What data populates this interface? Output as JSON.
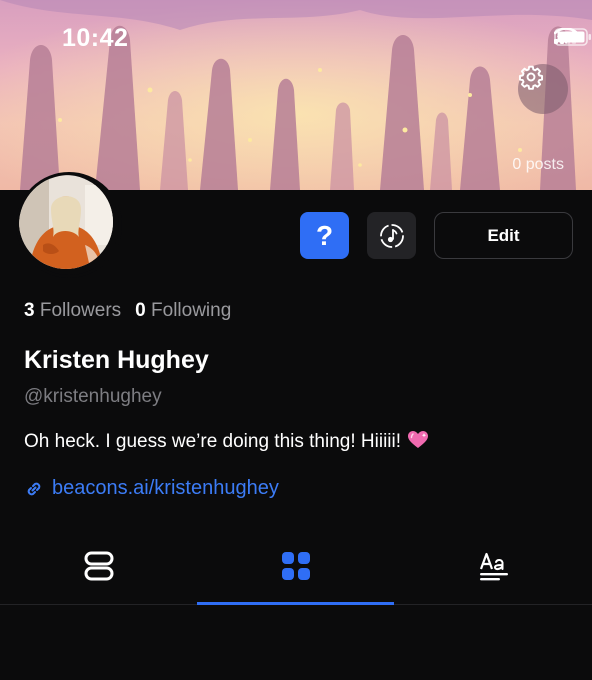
{
  "status_bar": {
    "time": "10:42"
  },
  "profile": {
    "posts_count": "0 posts",
    "followers_count": "3",
    "followers_label": "Followers",
    "following_count": "0",
    "following_label": "Following",
    "name": "Kristen Hughey",
    "handle": "@kristenhughey",
    "bio": "Oh heck. I guess we’re doing this thing! Hiiiii!",
    "link": "beacons.ai/kristenhughey"
  },
  "actions": {
    "help_label": "?",
    "edit_label": "Edit"
  },
  "tabs": [
    {
      "name": "links-tab",
      "icon": "stacked-rows-icon",
      "active": false
    },
    {
      "name": "grid-tab",
      "icon": "grid-icon",
      "active": true
    },
    {
      "name": "text-tab",
      "icon": "text-aa-icon",
      "active": false
    }
  ],
  "colors": {
    "accent": "#2f6ef5",
    "background": "#0b0b0c",
    "link": "#3c7cf6",
    "muted": "#9a9a9e"
  }
}
